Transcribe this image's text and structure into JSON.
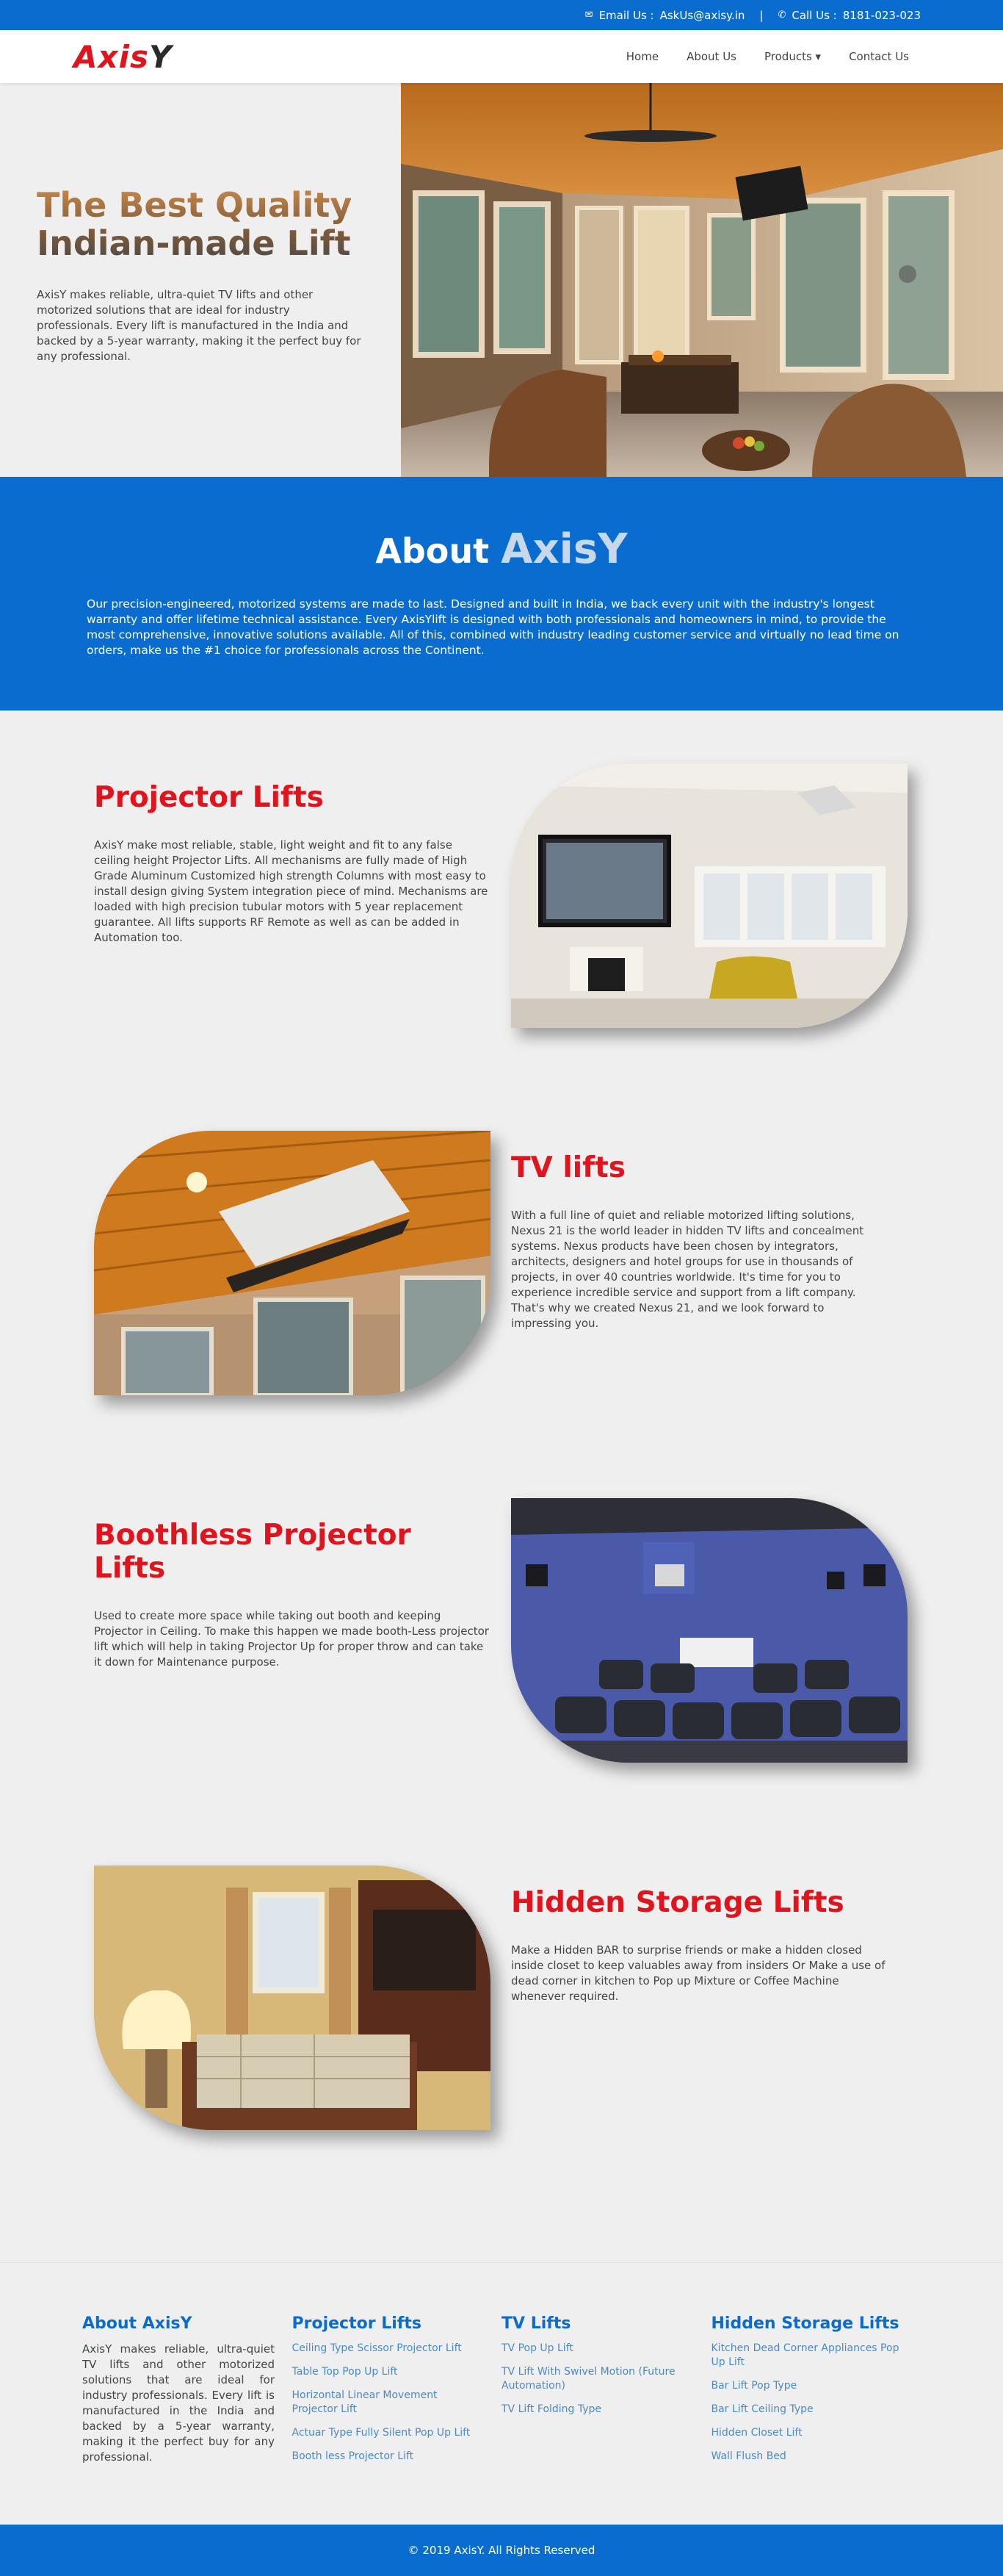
{
  "topbar": {
    "email_label": "Email Us :",
    "email": "AskUs@axisy.in",
    "separator": "|",
    "call_label": "Call Us :",
    "phone": "8181-023-023"
  },
  "nav": {
    "logo_main": "Axis",
    "logo_y": "Y",
    "links": [
      "Home",
      "About Us",
      "Products ▾",
      "Contact Us"
    ]
  },
  "hero": {
    "title_line1": "The Best Quality",
    "title_line2": "Indian-made Lift",
    "description": "AxisY makes reliable, ultra-quiet TV lifts and other motorized solutions that are ideal for industry professionals. Every lift is manufactured in the India and backed by a 5-year warranty, making it the perfect buy for any professional."
  },
  "about": {
    "title": "About",
    "brand": "AxisY",
    "text": "Our precision-engineered, motorized systems are made to last. Designed and built in India, we back every unit with the industry's longest warranty and offer lifetime technical assistance. Every AxisYlift is designed with both professionals and homeowners in mind, to provide the most comprehensive, innovative solutions available. All of this, combined with industry leading customer service and virtually no lead time on orders, make us the #1 choice for professionals across the Continent."
  },
  "products": [
    {
      "title": "Projector Lifts",
      "text": "AxisY make most reliable, stable, light weight and fit to any false ceiling height Projector Lifts. All mechanisms are fully made of High Grade Aluminum Customized high strength Columns with most easy to install design giving System integration piece of mind. Mechanisms are loaded with high precision tubular motors with 5 year replacement guarantee. All lifts supports RF Remote as well as can be added in Automation too."
    },
    {
      "title": "TV lifts",
      "text": "With a full line of quiet and reliable motorized lifting solutions, Nexus 21 is the world leader in hidden TV lifts and concealment systems. Nexus products have been chosen by integrators, architects, designers and hotel groups for use in thousands of projects, in over 40 countries worldwide. It's time for you to experience incredible service and support from a lift company. That's why we created Nexus 21, and we look forward to impressing you."
    },
    {
      "title": "Boothless Projector Lifts",
      "text": "Used to create more space while taking out booth and keeping Projector in Ceiling. To make this happen we made booth-Less projector lift which will help in taking Projector Up for proper throw and can take it down for Maintenance purpose."
    },
    {
      "title": "Hidden Storage Lifts",
      "text": "Make a Hidden BAR to surprise friends or make a hidden closed inside closet to keep valuables away from insiders Or Make a use of dead corner in kitchen to Pop up Mixture or Coffee Machine whenever required."
    }
  ],
  "footer": {
    "about_title": "About AxisY",
    "about_text": "AxisY makes reliable, ultra-quiet TV lifts and other motorized solutions that are ideal for industry professionals. Every lift is manufactured in the India and backed by a 5-year warranty, making it the perfect buy for any professional.",
    "projector_title": "Projector Lifts",
    "projector_links": [
      "Ceiling Type Scissor Projector Lift",
      "Table Top Pop Up Lift",
      "Horizontal Linear Movement Projector Lift",
      "Actuar Type Fully Silent Pop Up Lift",
      "Booth less Projector Lift"
    ],
    "tv_title": "TV Lifts",
    "tv_links": [
      "TV Pop Up Lift",
      "TV Lift With Swivel Motion (Future Automation)",
      "TV Lift Folding Type"
    ],
    "storage_title": "Hidden Storage Lifts",
    "storage_links": [
      "Kitchen Dead Corner Appliances Pop Up Lift",
      "Bar Lift Pop Type",
      "Bar Lift Ceiling Type",
      "Hidden Closet Lift",
      "Wall Flush Bed"
    ],
    "copyright": "© 2019 AxisY. All Rights Reserved"
  },
  "colors": {
    "primary": "#0a6ccf",
    "accent": "#e0141d"
  }
}
